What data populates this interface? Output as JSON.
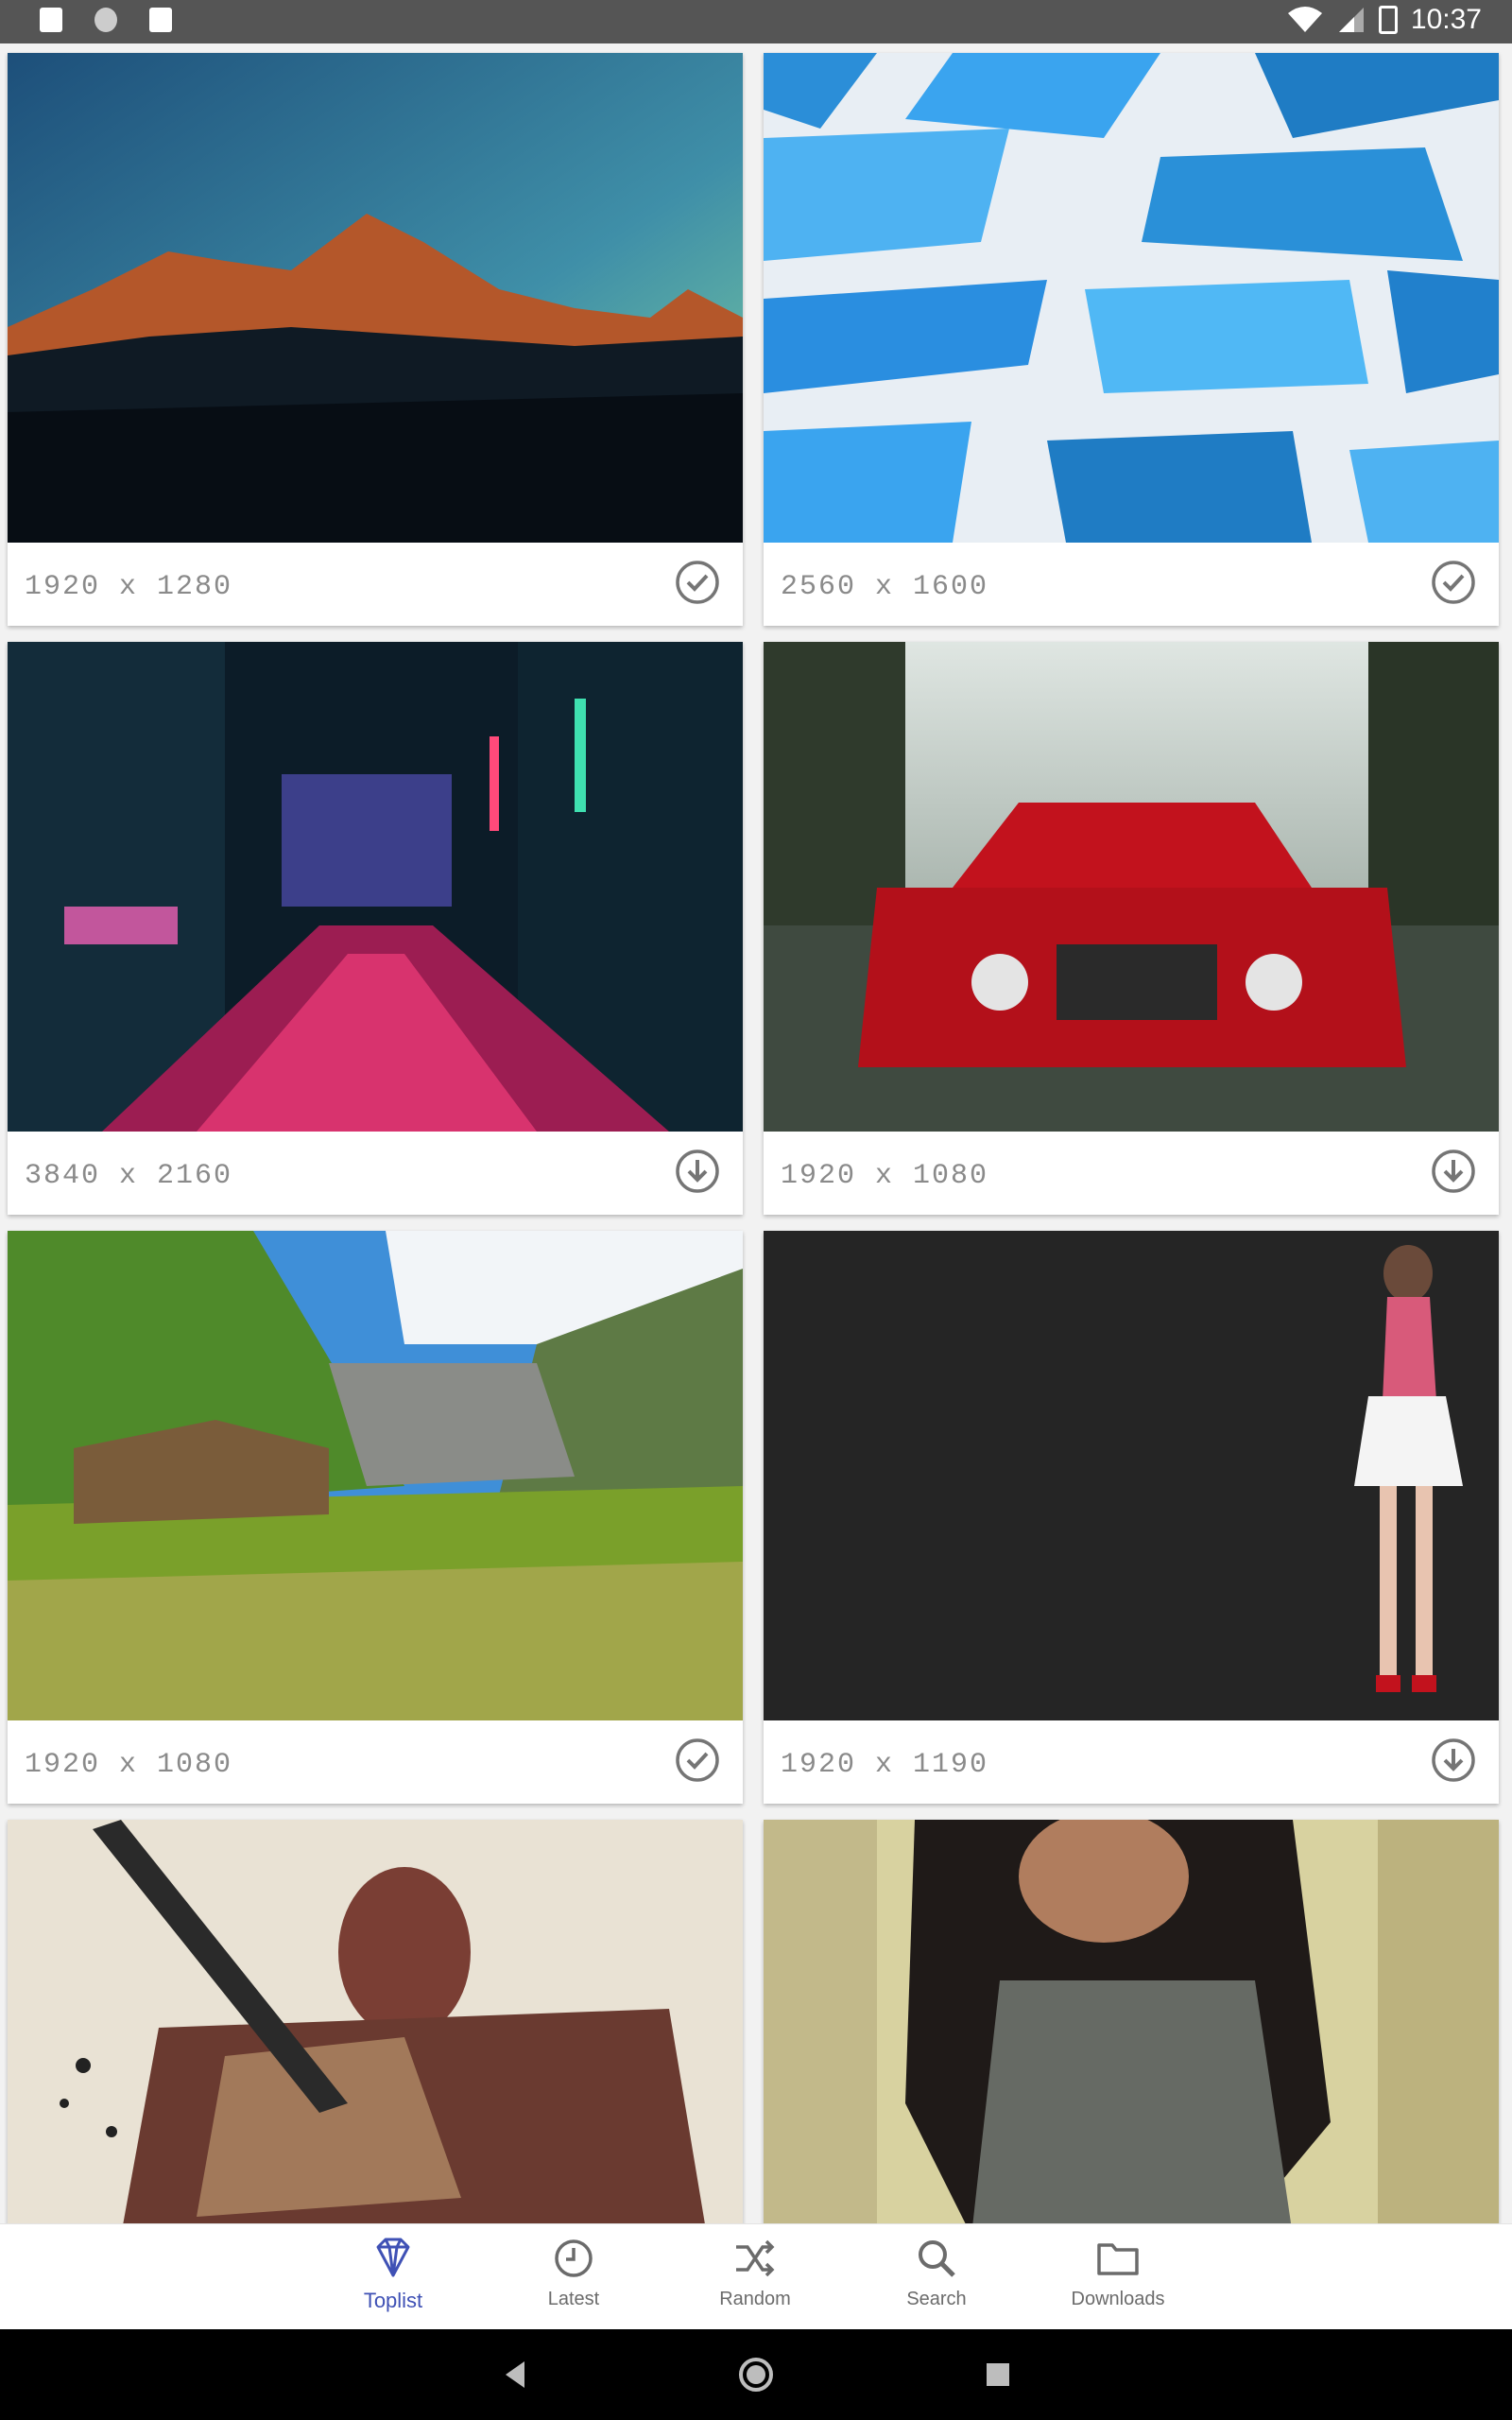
{
  "status_bar": {
    "time": "10:37",
    "left_icons": [
      "a-icon",
      "circle-icon",
      "sd-card-icon"
    ],
    "right_icons": [
      "wifi-icon",
      "signal-icon",
      "battery-charging-icon"
    ]
  },
  "wallpapers": [
    {
      "resolution": "1920 x 1280",
      "status": "downloaded",
      "status_icon": "check-circle-icon"
    },
    {
      "resolution": "2560 x 1600",
      "status": "downloaded",
      "status_icon": "check-circle-icon"
    },
    {
      "resolution": "3840 x 2160",
      "status": "not-downloaded",
      "status_icon": "download-icon"
    },
    {
      "resolution": "1920 x 1080",
      "status": "not-downloaded",
      "status_icon": "download-icon"
    },
    {
      "resolution": "1920 x 1080",
      "status": "downloaded",
      "status_icon": "check-circle-icon"
    },
    {
      "resolution": "1920 x 1190",
      "status": "not-downloaded",
      "status_icon": "download-icon"
    }
  ],
  "bottom_nav": {
    "items": [
      {
        "label": "Toplist",
        "icon": "diamond-icon",
        "active": true
      },
      {
        "label": "Latest",
        "icon": "clock-icon",
        "active": false
      },
      {
        "label": "Random",
        "icon": "shuffle-icon",
        "active": false
      },
      {
        "label": "Search",
        "icon": "search-icon",
        "active": false
      },
      {
        "label": "Downloads",
        "icon": "folder-icon",
        "active": false
      }
    ]
  },
  "colors": {
    "accent": "#3f51b5",
    "inactive_nav": "#6b6b6b",
    "resolution_text": "#8a8a8a",
    "status_icon": "#757575"
  }
}
